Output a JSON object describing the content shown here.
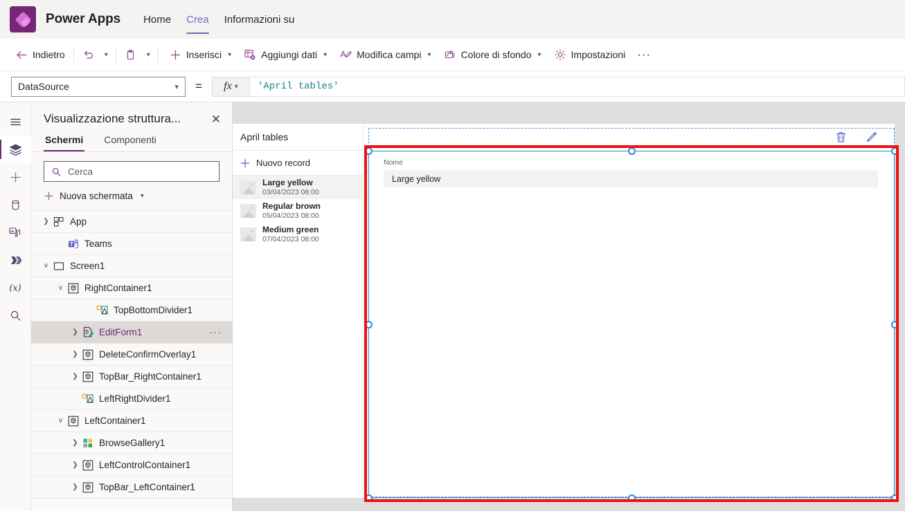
{
  "header": {
    "brand": "Power Apps",
    "logo_color": "#742774",
    "nav": [
      {
        "label": "Home",
        "active": false
      },
      {
        "label": "Crea",
        "active": true
      },
      {
        "label": "Informazioni su",
        "active": false
      }
    ]
  },
  "toolbar": {
    "back": "Indietro",
    "insert": "Inserisci",
    "add_data": "Aggiungi dati",
    "edit_fields": "Modifica campi",
    "background_color": "Colore di sfondo",
    "settings": "Impostazioni",
    "overflow": "···",
    "icons": {
      "back": "arrow-left-icon",
      "undo": "undo-icon",
      "paste": "clipboard-icon",
      "insert": "plus-icon",
      "add_data": "table-add-icon",
      "edit_fields": "edit-fields-icon",
      "background": "paint-bucket-icon",
      "settings": "gear-icon"
    }
  },
  "formula_bar": {
    "property": "DataSource",
    "equals": "=",
    "fx_label": "fx",
    "value": "'April tables'",
    "value_color": "#1a7f8e"
  },
  "rail": {
    "items": [
      {
        "name": "hamburger-icon",
        "active": false
      },
      {
        "name": "layers-icon",
        "active": true
      },
      {
        "name": "plus-icon",
        "active": false
      },
      {
        "name": "database-icon",
        "active": false
      },
      {
        "name": "media-icon",
        "active": false
      },
      {
        "name": "power-automate-icon",
        "active": false
      },
      {
        "name": "variables-icon",
        "active": false
      },
      {
        "name": "search-icon",
        "active": false
      }
    ]
  },
  "tree_panel": {
    "title": "Visualizzazione struttura...",
    "close_label": "✕",
    "tabs": [
      {
        "label": "Schermi",
        "active": true
      },
      {
        "label": "Componenti",
        "active": false
      }
    ],
    "search_placeholder": "Cerca",
    "new_screen": "Nuova schermata",
    "items": [
      {
        "label": "App",
        "indent": 0,
        "chevron": "collapsed",
        "icon": "app-icon",
        "selected": false,
        "more": false
      },
      {
        "label": "Teams",
        "indent": 1,
        "chevron": "none",
        "icon": "teams-icon",
        "selected": false,
        "more": false
      },
      {
        "label": "Screen1",
        "indent": 0,
        "chevron": "expanded",
        "icon": "screen-icon",
        "selected": false,
        "more": false
      },
      {
        "label": "RightContainer1",
        "indent": 1,
        "chevron": "expanded",
        "icon": "container-icon",
        "selected": false,
        "more": false
      },
      {
        "label": "TopBottomDivider1",
        "indent": 3,
        "chevron": "none",
        "icon": "divider-icon",
        "selected": false,
        "more": false
      },
      {
        "label": "EditForm1",
        "indent": 2,
        "chevron": "collapsed",
        "icon": "form-icon",
        "selected": true,
        "more": true
      },
      {
        "label": "DeleteConfirmOverlay1",
        "indent": 2,
        "chevron": "collapsed",
        "icon": "container-icon",
        "selected": false,
        "more": false
      },
      {
        "label": "TopBar_RightContainer1",
        "indent": 2,
        "chevron": "collapsed",
        "icon": "container-icon",
        "selected": false,
        "more": false
      },
      {
        "label": "LeftRightDivider1",
        "indent": 2,
        "chevron": "none",
        "icon": "divider-icon",
        "selected": false,
        "more": false
      },
      {
        "label": "LeftContainer1",
        "indent": 1,
        "chevron": "expanded",
        "icon": "container-icon",
        "selected": false,
        "more": false
      },
      {
        "label": "BrowseGallery1",
        "indent": 2,
        "chevron": "collapsed",
        "icon": "gallery-icon",
        "selected": false,
        "more": false
      },
      {
        "label": "LeftControlContainer1",
        "indent": 2,
        "chevron": "collapsed",
        "icon": "container-icon",
        "selected": false,
        "more": false
      },
      {
        "label": "TopBar_LeftContainer1",
        "indent": 2,
        "chevron": "collapsed",
        "icon": "container-icon",
        "selected": false,
        "more": false
      }
    ]
  },
  "canvas": {
    "gallery": {
      "title": "April tables",
      "new_record": "Nuovo record",
      "records": [
        {
          "name": "Large yellow",
          "date": "03/04/2023 08:00",
          "selected": true
        },
        {
          "name": "Regular brown",
          "date": "05/04/2023 08:00",
          "selected": false
        },
        {
          "name": "Medium green",
          "date": "07/04/2023 08:00",
          "selected": false
        }
      ]
    },
    "form": {
      "delete_icon": "trash-icon",
      "edit_icon": "pencil-icon",
      "field_label": "Nome",
      "field_value": "Large yellow"
    },
    "selection": {
      "accent_color": "#2b88d8",
      "annotation_color": "#ee1111"
    }
  }
}
